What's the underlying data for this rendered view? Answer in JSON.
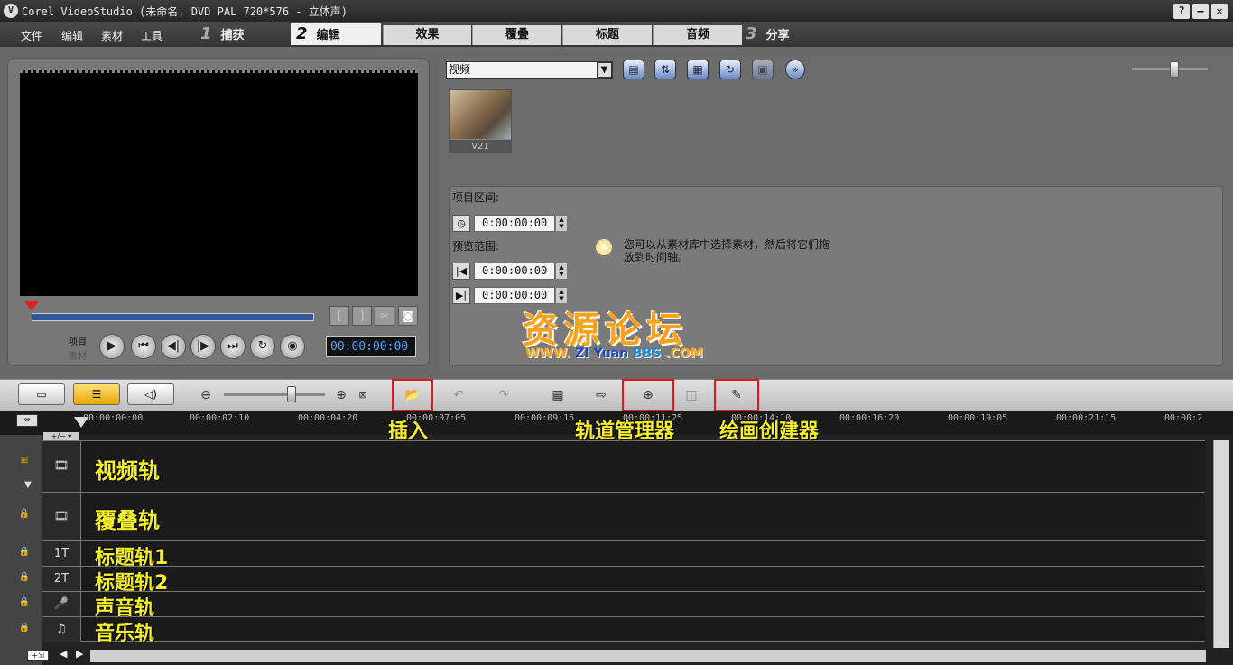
{
  "window": {
    "title": "Corel VideoStudio (未命名, DVD PAL 720*576 - 立体声)",
    "help": "?",
    "minimize": "–",
    "close": "✕"
  },
  "menu": [
    "文件",
    "编辑",
    "素材",
    "工具"
  ],
  "steps": [
    {
      "num": "1",
      "label": "捕获"
    },
    {
      "num": "2",
      "label": "编辑"
    },
    {
      "num": "3",
      "label": "分享"
    }
  ],
  "subtabs": [
    "效果",
    "覆叠",
    "标题",
    "音频"
  ],
  "preview": {
    "project_label": "项目",
    "clip_label": "素材",
    "timecode": "00:00:00:00",
    "controls": [
      "▶",
      "⏮",
      "◀|",
      "|▶",
      "⏭",
      "↻",
      "◉"
    ],
    "mark_buttons": [
      "[",
      "]",
      "✂",
      "◙"
    ]
  },
  "library": {
    "category": "视频",
    "thumb_label": "V21",
    "icons": [
      "folder-icon",
      "sort-icon",
      "view-icon",
      "refresh-icon",
      "import-icon",
      "expand-icon"
    ]
  },
  "options": {
    "project_range_label": "项目区间:",
    "duration": "0:00:00:00",
    "preview_range_label": "预览范围:",
    "start": "0:00:00:00",
    "end": "0:00:00:00",
    "hint": "您可以从素材库中选择素材，然后将它们拖放到时间轴。"
  },
  "watermark": {
    "title": "资源论坛",
    "sub_www": "WWW.",
    "sub_zi": "ZI",
    "sub_yuan": "Yuan",
    "sub_bbs": "BBS",
    "sub_com": ".COM"
  },
  "timeline_ticks": [
    "00:00:00:00",
    "00:00:02:10",
    "00:00:04:20",
    "00:00:07:05",
    "00:00:09:15",
    "00:00:11:25",
    "00:00:14:10",
    "00:00:16:20",
    "00:00:19:05",
    "00:00:21:15",
    "00:00:2"
  ],
  "annotations": {
    "insert": "插入",
    "track_manager": "轨道管理器",
    "paint_creator": "绘画创建器"
  },
  "tracks": [
    {
      "label": "视频轨",
      "icon": "🎞"
    },
    {
      "label": "覆叠轨",
      "icon": "🎞"
    },
    {
      "label": "标题轨1",
      "icon": "1T"
    },
    {
      "label": "标题轨2",
      "icon": "2T"
    },
    {
      "label": "声音轨",
      "icon": "🎤"
    },
    {
      "label": "音乐轨",
      "icon": "♫"
    }
  ]
}
